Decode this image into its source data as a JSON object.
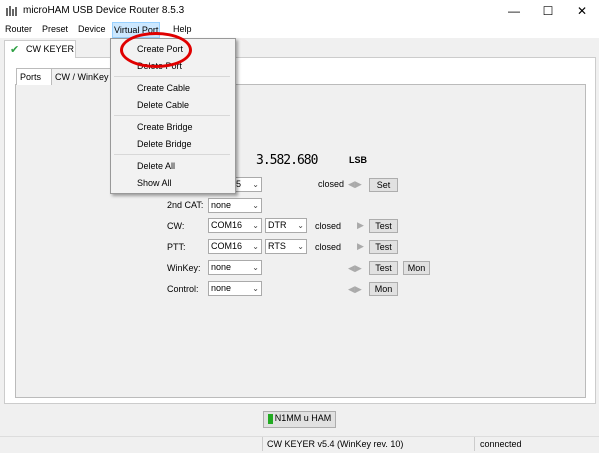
{
  "window": {
    "title": "microHAM USB Device Router 8.5.3",
    "minimize": "—",
    "maximize": "☐",
    "close": "✕"
  },
  "menu": {
    "items": [
      "Router",
      "Preset",
      "Device",
      "Virtual Port",
      "Help"
    ],
    "open_index": 3
  },
  "dropdown": {
    "groups": [
      [
        "Create Port",
        "Delete Port"
      ],
      [
        "Create Cable",
        "Delete Cable"
      ],
      [
        "Create Bridge",
        "Delete Bridge"
      ],
      [
        "Delete All",
        "Show All"
      ]
    ],
    "highlighted": "Create Port"
  },
  "device_tab": {
    "label": "CW KEYER",
    "check_icon": "✔"
  },
  "inner_tabs": [
    "Ports",
    "CW / WinKey"
  ],
  "frequency": "3.582.680",
  "mode": "LSB",
  "ports": {
    "cat": {
      "value": "15",
      "status": "closed",
      "button": "Set"
    },
    "cat2": {
      "label": "2nd CAT:",
      "value": "none"
    },
    "cw": {
      "label": "CW:",
      "value": "COM16",
      "line": "DTR",
      "status": "closed",
      "button": "Test"
    },
    "ptt": {
      "label": "PTT:",
      "value": "COM16",
      "line": "RTS",
      "status": "closed",
      "button": "Test"
    },
    "winkey": {
      "label": "WinKey:",
      "value": "none",
      "button1": "Test",
      "button2": "Mon"
    },
    "control": {
      "label": "Control:",
      "value": "none",
      "button": "Mon"
    }
  },
  "status_button": "N1MM u HAM",
  "statusbar": {
    "device": "CW KEYER v5.4 (WinKey rev. 10)",
    "state": "connected"
  },
  "colors": {
    "highlight_circle": "#e00000",
    "check": "#2ea043",
    "led": "#22aa22",
    "menu_open": "#cce8ff"
  }
}
